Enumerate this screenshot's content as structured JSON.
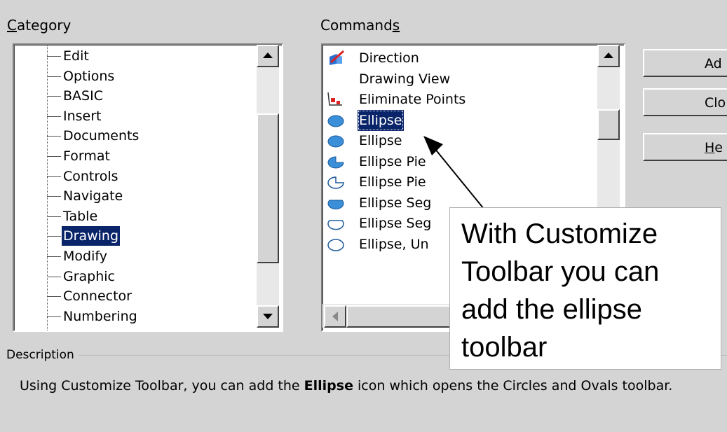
{
  "category": {
    "label_prefix": "",
    "label_accel": "C",
    "label_rest": "ategory",
    "items": [
      "Edit",
      "Options",
      "BASIC",
      "Insert",
      "Documents",
      "Format",
      "Controls",
      "Navigate",
      "Table",
      "Drawing",
      "Modify",
      "Graphic",
      "Connector",
      "Numbering"
    ],
    "selected_index": 9
  },
  "commands": {
    "label_main": "Command",
    "label_accel": "s",
    "items": [
      {
        "label": "Direction",
        "icon": "direction-3d-icon"
      },
      {
        "label": "Drawing View",
        "icon": ""
      },
      {
        "label": "Eliminate Points",
        "icon": "eliminate-points-icon"
      },
      {
        "label": "Ellipse",
        "icon": "ellipse-icon"
      },
      {
        "label": "Ellipse",
        "icon": "ellipse-icon"
      },
      {
        "label": "Ellipse Pie",
        "icon": "ellipse-pie-icon"
      },
      {
        "label": "Ellipse Pie",
        "icon": "ellipse-pie-unfilled-icon"
      },
      {
        "label": "Ellipse Seg",
        "icon": "ellipse-segment-icon"
      },
      {
        "label": "Ellipse Seg",
        "icon": "ellipse-segment-unfilled-icon"
      },
      {
        "label": "Ellipse, Un",
        "icon": "ellipse-unfilled-icon"
      }
    ],
    "selected_index": 3
  },
  "buttons": {
    "add": {
      "text": "Ad"
    },
    "close": {
      "text": "Clo"
    },
    "help": {
      "accel": "H",
      "rest": "e"
    }
  },
  "description": {
    "label": "Description",
    "text_before": "Using Customize Toolbar, you can add the ",
    "text_bold": "Ellipse",
    "text_after": " icon which opens the Circles and Ovals toolbar."
  },
  "callout": {
    "text": "With Customize Toolbar you can add the ellipse toolbar"
  },
  "colors": {
    "selection": "#0a246a",
    "window_bg": "#d4d4d4",
    "ellipse_fill": "#3a8fd8"
  }
}
